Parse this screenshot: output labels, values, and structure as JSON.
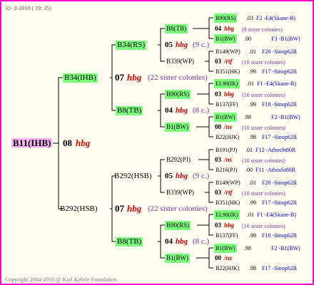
{
  "header_date": "31- 3-2010 ( 19: 35)",
  "footer": "Copyright 2004-2010 @ Karl Kehrle Foundation.",
  "root": {
    "name": "B11(IHB)",
    "year": "08",
    "tag": "hbg"
  },
  "g1": [
    {
      "name": "B34(IHB)",
      "year": "07",
      "tag": "hbg",
      "sisters": "(22 sister colonies)"
    },
    {
      "name": "B292(HSB)",
      "year": "07",
      "tag": "hbg",
      "sisters": "(22 sister colonies)"
    }
  ],
  "g2": [
    {
      "name": "B34(RS)",
      "year": "05",
      "tag": "hbg",
      "sisters": "(9 c.)"
    },
    {
      "name": "B8(TB)",
      "year": "04",
      "tag": "hbg",
      "sisters": "(8 c.)"
    },
    {
      "name": "B292(HSB)",
      "year": "05",
      "tag": "hbg",
      "sisters": "(9 c.)"
    },
    {
      "name": "B8(TB)",
      "year": "04",
      "tag": "hbg",
      "sisters": "(8 c.)"
    }
  ],
  "g3": [
    {
      "name": "B8(TB)",
      "year": "04",
      "tag": "hbg",
      "sisters": "(8 sister colonies)"
    },
    {
      "name": "B339(WP)",
      "year": "03",
      "tag": "/rtf",
      "sisters": "(10 sister colonies)"
    },
    {
      "name": "B90(RS)",
      "year": "03",
      "tag": "hbg",
      "sisters": "(10 sister colonies)"
    },
    {
      "name": "B1(BW)",
      "year": "00",
      "tag": "/ns",
      "sisters": "(10 sister colonies)"
    },
    {
      "name": "B292(PJ)",
      "year": "03",
      "tag": "/ns",
      "sisters": "(10 sister colonies)"
    },
    {
      "name": "B339(WP)",
      "year": "03",
      "tag": "/rtf",
      "sisters": "(10 sister colonies)"
    },
    {
      "name": "B90(RS)",
      "year": "03",
      "tag": "hbg",
      "sisters": "(10 sister colonies)"
    },
    {
      "name": "B1(BW)",
      "year": "00",
      "tag": "/ns",
      "sisters": ""
    }
  ],
  "g4": [
    {
      "name": "B90(RS)",
      "val": ".03",
      "ref": "F2 -E4(Skane-B)"
    },
    {
      "name": "B1(BW)",
      "val": ".00",
      "ref": "F3 -B1(BW)"
    },
    {
      "name": "B149(WP)",
      "val": ".01",
      "ref": "F20 -Sinop62R"
    },
    {
      "name": "B351(HK)",
      "val": ".99",
      "ref": "F17 -Sinop62R"
    },
    {
      "name": "EL90(IK)",
      "val": ".01",
      "ref": "F1 -E4(Skane-B)"
    },
    {
      "name": "B137(FF)",
      "val": ".99",
      "ref": "F18 -Sinop62R"
    },
    {
      "name": "B1(BW)",
      "val": ".98",
      "ref": "F2 -B1(BW)"
    },
    {
      "name": "B22(HJK)",
      "val": ".98",
      "ref": "F17 -Sinop62R"
    },
    {
      "name": "B191(PJ)",
      "val": ".01",
      "ref": "F12 -AthosSt80R"
    },
    {
      "name": "B216(PJ)",
      "val": ".00",
      "ref": "F11 -AthosSt80R"
    },
    {
      "name": "B149(WP)",
      "val": ".01",
      "ref": "F20 -Sinop62R"
    },
    {
      "name": "B351(HK)",
      "val": ".99",
      "ref": "F17 -Sinop62R"
    },
    {
      "name": "EL90(IK)",
      "val": ".01",
      "ref": "F1 -E4(Skane-B)"
    },
    {
      "name": "B137(FF)",
      "val": ".99",
      "ref": "F18 -Sinop62R"
    },
    {
      "name": "B1(BW)",
      "val": ".98",
      "ref": "F2 -B1(BW)"
    },
    {
      "name": "B22(HJK)",
      "val": ".98",
      "ref": "F17 -Sinop62R"
    }
  ]
}
